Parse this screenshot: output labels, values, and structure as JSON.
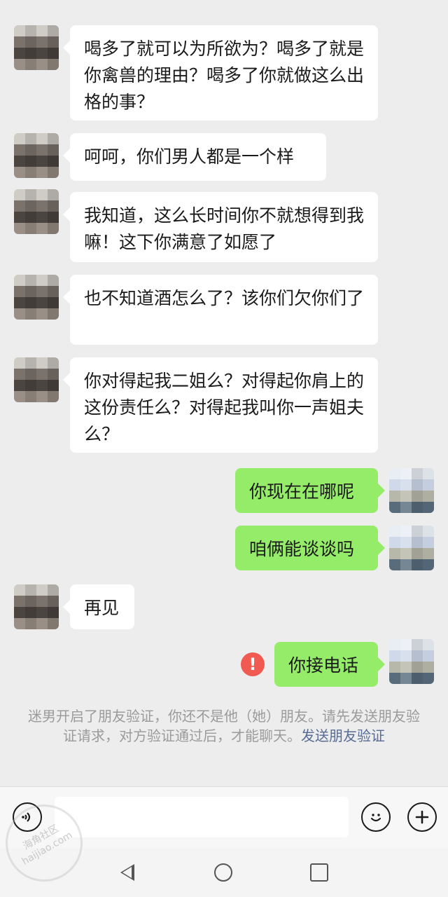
{
  "messages": [
    {
      "id": "m1",
      "side": "left",
      "text": "喝多了就可以为所欲为？喝多了就是你禽兽的理由？喝多了你就做这么出格的事？"
    },
    {
      "id": "m2",
      "side": "left",
      "text": "呵呵，你们男人都是一个样"
    },
    {
      "id": "m3",
      "side": "left",
      "text": "我知道，这么长时间你不就想得到我嘛！这下你满意了如愿了"
    },
    {
      "id": "m4",
      "side": "left",
      "text": "也不知道酒怎么了？该你们欠你们了"
    },
    {
      "id": "m5",
      "side": "left",
      "text": "你对得起我二姐么？对得起你肩上的这份责任么？对得起我叫你一声姐夫么？"
    },
    {
      "id": "m6",
      "side": "right",
      "text": "你现在在哪呢"
    },
    {
      "id": "m7",
      "side": "right",
      "text": "咱俩能谈谈吗"
    },
    {
      "id": "m8",
      "side": "left",
      "text": "再见"
    },
    {
      "id": "m9",
      "side": "right",
      "text": "你接电话",
      "failed": true
    }
  ],
  "system_notice": {
    "text": "迷男开启了朋友验证，你还不是他（她）朋友。请先发送朋友验证请求，对方验证通过后，才能聊天。",
    "link": "发送朋友验证"
  },
  "watermark": {
    "line1": "海角社区",
    "line2": "haijiao.com"
  },
  "icons": {
    "voice": "voice-icon",
    "emoji": "emoji-icon",
    "plus": "plus-icon",
    "error": "error-icon",
    "back": "back-icon",
    "home": "home-icon",
    "recents": "recents-icon"
  },
  "colors": {
    "background": "#ededed",
    "left_bubble": "#ffffff",
    "right_bubble": "#95ec69",
    "link": "#576b95",
    "error": "#f05a51"
  }
}
